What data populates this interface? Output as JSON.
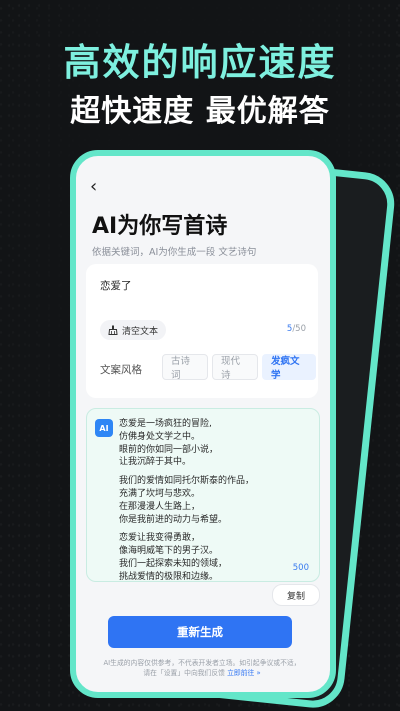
{
  "promo": {
    "headline": "高效的响应速度",
    "subhead": "超快速度 最优解答"
  },
  "colors": {
    "accent": "#63E6C9",
    "headline": "#7EF0DF",
    "primary": "#2F74F3",
    "background": "#121416"
  },
  "screen": {
    "back_icon": "‹",
    "title": "AI为你写首诗",
    "intro": "依据关键词，AI为你生成一段 文艺诗句",
    "input": {
      "keyword": "恋爱了",
      "clear_label": "清空文本",
      "clear_icon": "broom-icon",
      "char_current": "5",
      "char_total": "/50"
    },
    "style": {
      "label": "文案风格",
      "options": [
        "古诗词",
        "现代诗",
        "发疯文学"
      ],
      "selected": "发疯文学"
    },
    "result": {
      "badge": "AI",
      "stanzas": [
        [
          "恋爱是一场疯狂的冒险,",
          "仿佛身处文学之中。",
          "眼前的你如同一部小说，",
          "让我沉醉于其中。"
        ],
        [
          "我们的爱情如同托尔斯泰的作品，",
          "充满了坎坷与悲欢。",
          "在那漫漫人生路上，",
          "你是我前进的动力与希望。"
        ],
        [
          "恋爱让我变得勇敢，",
          "像海明威笔下的男子汉。",
          "我们一起探索未知的领域，",
          "挑战爱情的极限和边缘。"
        ]
      ],
      "word_count": "500"
    },
    "copy_label": "复制",
    "regenerate_label": "重新生成",
    "footer": {
      "line1": "AI生成的内容仅供参考，不代表开发者立场。如引起争议或不适，",
      "line2": "请在「设置」中向我们反馈",
      "link": "立即前往 »"
    }
  }
}
